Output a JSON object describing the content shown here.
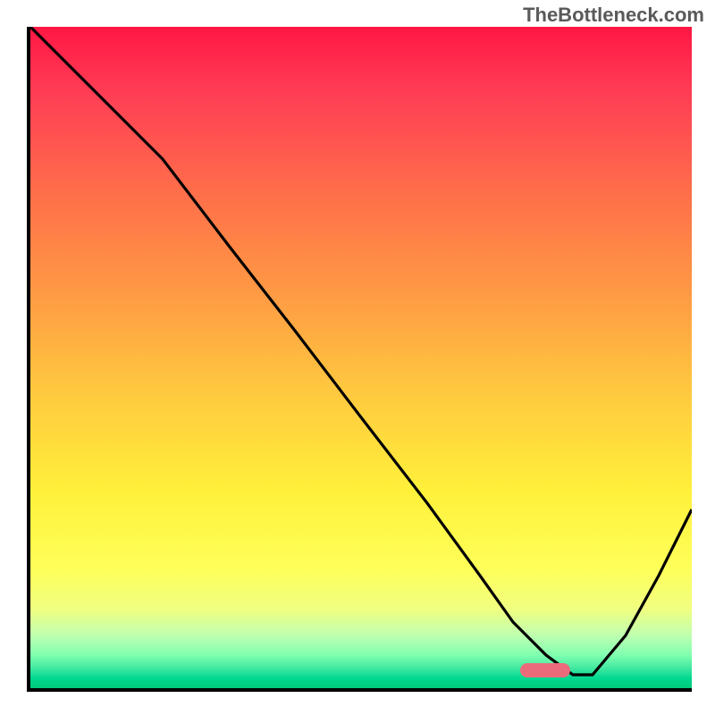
{
  "watermark": "TheBottleneck.com",
  "chart_data": {
    "type": "line",
    "title": "",
    "xlabel": "",
    "ylabel": "",
    "xlim": [
      0,
      100
    ],
    "ylim": [
      0,
      100
    ],
    "background_gradient": "red-yellow-green vertical",
    "series": [
      {
        "name": "bottleneck-curve",
        "x": [
          0,
          12,
          20,
          30,
          40,
          50,
          60,
          68,
          73,
          78,
          82,
          85,
          90,
          95,
          100
        ],
        "values": [
          100,
          88,
          80,
          67,
          54,
          41,
          28,
          17,
          10,
          5,
          2,
          2,
          8,
          17,
          27
        ]
      }
    ],
    "marker": {
      "name": "optimal-zone",
      "x_start": 78,
      "x_end": 85,
      "color": "#ec6b7a"
    }
  }
}
